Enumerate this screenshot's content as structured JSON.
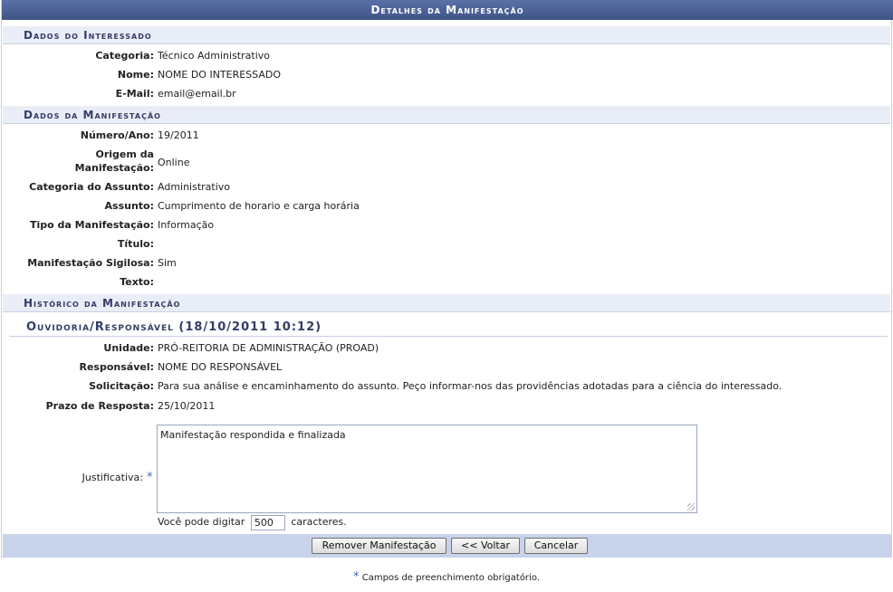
{
  "window": {
    "title": "Detalhes da Manifestação"
  },
  "sections": {
    "interessado": {
      "title": "Dados do Interessado",
      "fields": [
        {
          "label": "Categoria:",
          "value": "Técnico Administrativo"
        },
        {
          "label": "Nome:",
          "value": "NOME DO INTERESSADO"
        },
        {
          "label": "E-Mail:",
          "value": "email@email.br"
        }
      ]
    },
    "manifestacao": {
      "title": "Dados da Manifestação",
      "numero": {
        "label": "Número/Ano:",
        "value": "19/2011"
      },
      "origem": {
        "label_line1": "Origem da",
        "label_line2": "Manifestação:",
        "value": "Online"
      },
      "categoria_assunto": {
        "label": "Categoria do Assunto:",
        "value": "Administrativo"
      },
      "assunto": {
        "label": "Assunto:",
        "value": "Cumprimento de horario e carga horária"
      },
      "tipo": {
        "label": "Tipo da Manifestação:",
        "value": "Informação"
      },
      "titulo": {
        "label": "Título:",
        "value": ""
      },
      "sigilosa": {
        "label": "Manifestação Sigilosa:",
        "value": "Sim"
      },
      "texto": {
        "label": "Texto:",
        "value": ""
      }
    },
    "historico": {
      "title": "Histórico da Manifestação",
      "subtitle": "Ouvidoria/Responsável (18/10/2011 10:12)",
      "fields": [
        {
          "label": "Unidade:",
          "value": "PRÓ-REITORIA DE ADMINISTRAÇÃO (PROAD)"
        },
        {
          "label": "Responsável:",
          "value": "NOME DO RESPONSÁVEL"
        },
        {
          "label": "Solicitação:",
          "value": "Para sua análise e encaminhamento do assunto. Peço informar-nos das providências adotadas para a ciência do interessado."
        },
        {
          "label": "Prazo de Resposta:",
          "value": "25/10/2011"
        }
      ],
      "justificativa": {
        "label": "Justificativa:",
        "value": "Manifestação respondida e finalizada"
      },
      "char_counter": {
        "prefix": "Você pode digitar",
        "count": "500",
        "suffix": "caracteres."
      }
    }
  },
  "buttons": {
    "remover": "Remover Manifestação",
    "voltar": "<< Voltar",
    "cancelar": "Cancelar"
  },
  "footnote": {
    "star": "*",
    "text": "Campos de preenchimento obrigatório."
  },
  "colors": {
    "title_bar": "#4a5f96",
    "section_bg": "#e9edf6",
    "footer_bar": "#c8d3ea",
    "required_star": "#3a67c8"
  }
}
